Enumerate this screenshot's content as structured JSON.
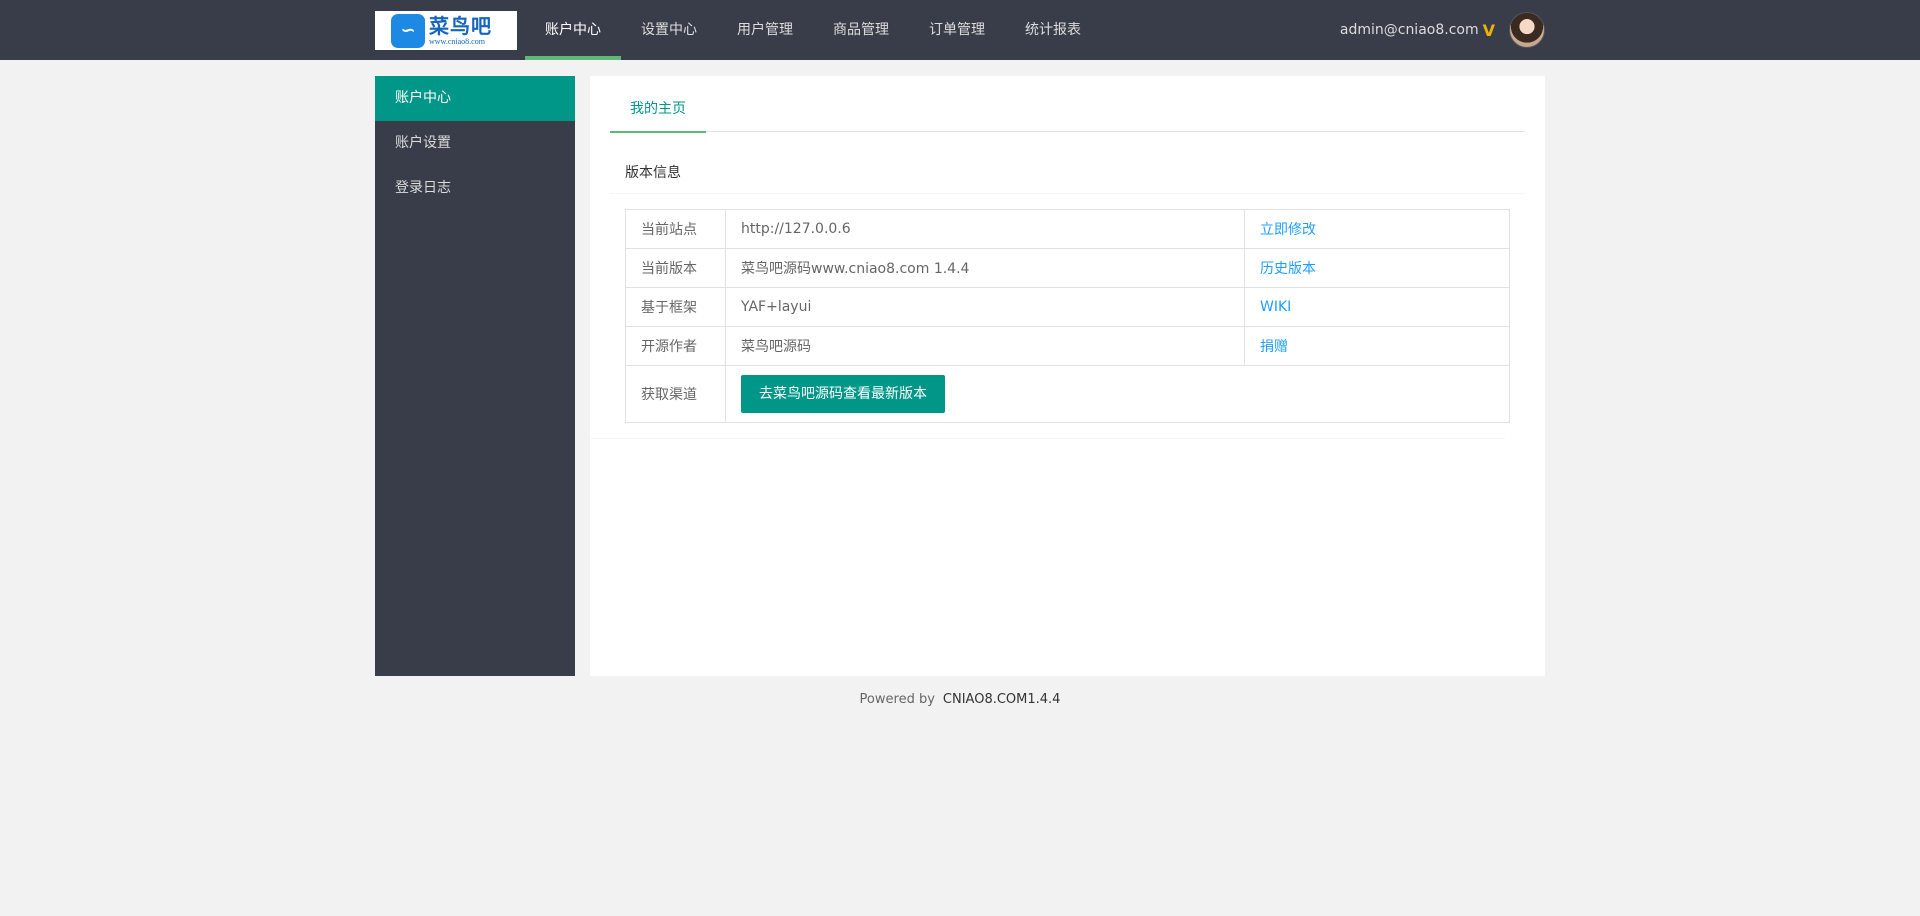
{
  "header": {
    "logo": {
      "mark": "∽",
      "cn": "菜鸟吧",
      "url": "www.cniao8.com"
    },
    "nav": [
      {
        "label": "账户中心",
        "active": true
      },
      {
        "label": "设置中心"
      },
      {
        "label": "用户管理"
      },
      {
        "label": "商品管理"
      },
      {
        "label": "订单管理"
      },
      {
        "label": "统计报表"
      }
    ],
    "user_email": "admin@cniao8.com",
    "vip_icon": "V"
  },
  "sidebar": {
    "items": [
      {
        "label": "账户中心",
        "active": true
      },
      {
        "label": "账户设置"
      },
      {
        "label": "登录日志"
      }
    ]
  },
  "main": {
    "tab": "我的主页",
    "card_title": "版本信息",
    "rows": [
      {
        "label": "当前站点",
        "value": "http://127.0.0.6",
        "link": "立即修改"
      },
      {
        "label": "当前版本",
        "value": "菜鸟吧源码www.cniao8.com 1.4.4",
        "link": "历史版本"
      },
      {
        "label": "基于框架",
        "value": "YAF+layui",
        "link": "WIKI"
      },
      {
        "label": "开源作者",
        "value": "菜鸟吧源码",
        "link": "捐赠"
      }
    ],
    "channel_label": "获取渠道",
    "channel_button": "去菜鸟吧源码查看最新版本"
  },
  "footer": {
    "powered": "Powered by",
    "brand": "CNIAO8.COM1.4.4"
  },
  "colors": {
    "header_bg": "#393d49",
    "accent": "#009688",
    "nav_underline": "#5fb878",
    "link": "#1e9fff",
    "vip": "#f0b400"
  }
}
